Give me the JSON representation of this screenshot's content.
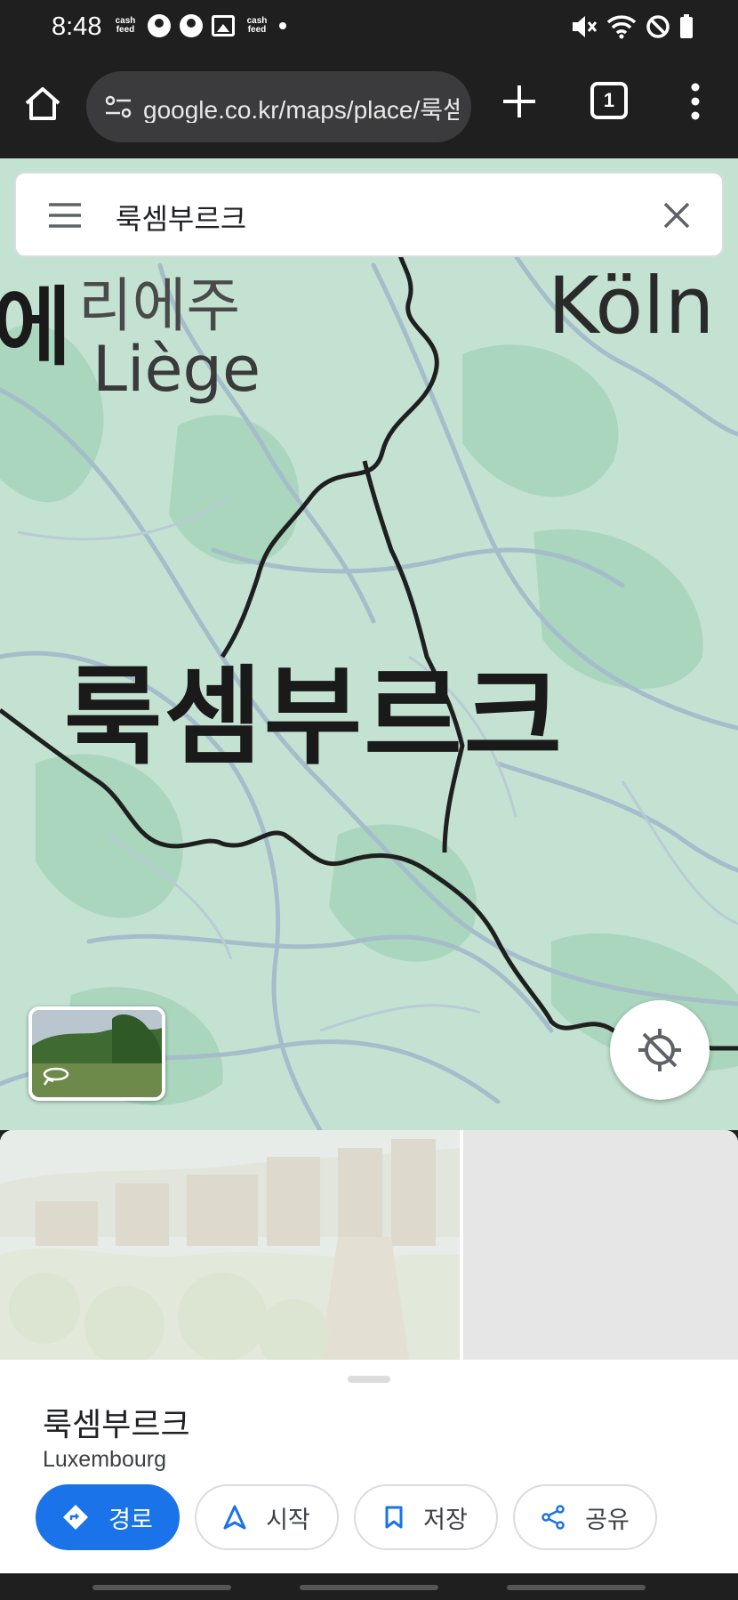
{
  "status_bar": {
    "time": "8:48",
    "cash_feed_label": "cash feed",
    "left_icons": [
      "cash-feed-icon",
      "account-icon",
      "account-icon",
      "image-icon",
      "cash-feed-icon",
      "dot-icon"
    ],
    "right_icons": [
      "mute-icon",
      "wifi-icon",
      "do-not-disturb-icon",
      "battery-icon"
    ]
  },
  "browser": {
    "url": "google.co.kr/maps/place/룩셈부르크",
    "tab_count": "1"
  },
  "search": {
    "query": "룩셈부르크"
  },
  "map": {
    "labels": {
      "belgium_fragment": "에",
      "liege_ko": "리에주",
      "liege": "Liège",
      "koln": "Köln",
      "luxembourg": "룩셈부르크"
    }
  },
  "place": {
    "name": "룩셈부르크",
    "subtitle": "Luxembourg"
  },
  "actions": {
    "directions": "경로",
    "start": "시작",
    "save": "저장",
    "share": "공유"
  },
  "colors": {
    "accent": "#1a73e8",
    "map_base": "#c4e2d2",
    "map_forest": "#a9d6bd",
    "border_line": "#1f1f1f",
    "road": "#a5bccb"
  }
}
